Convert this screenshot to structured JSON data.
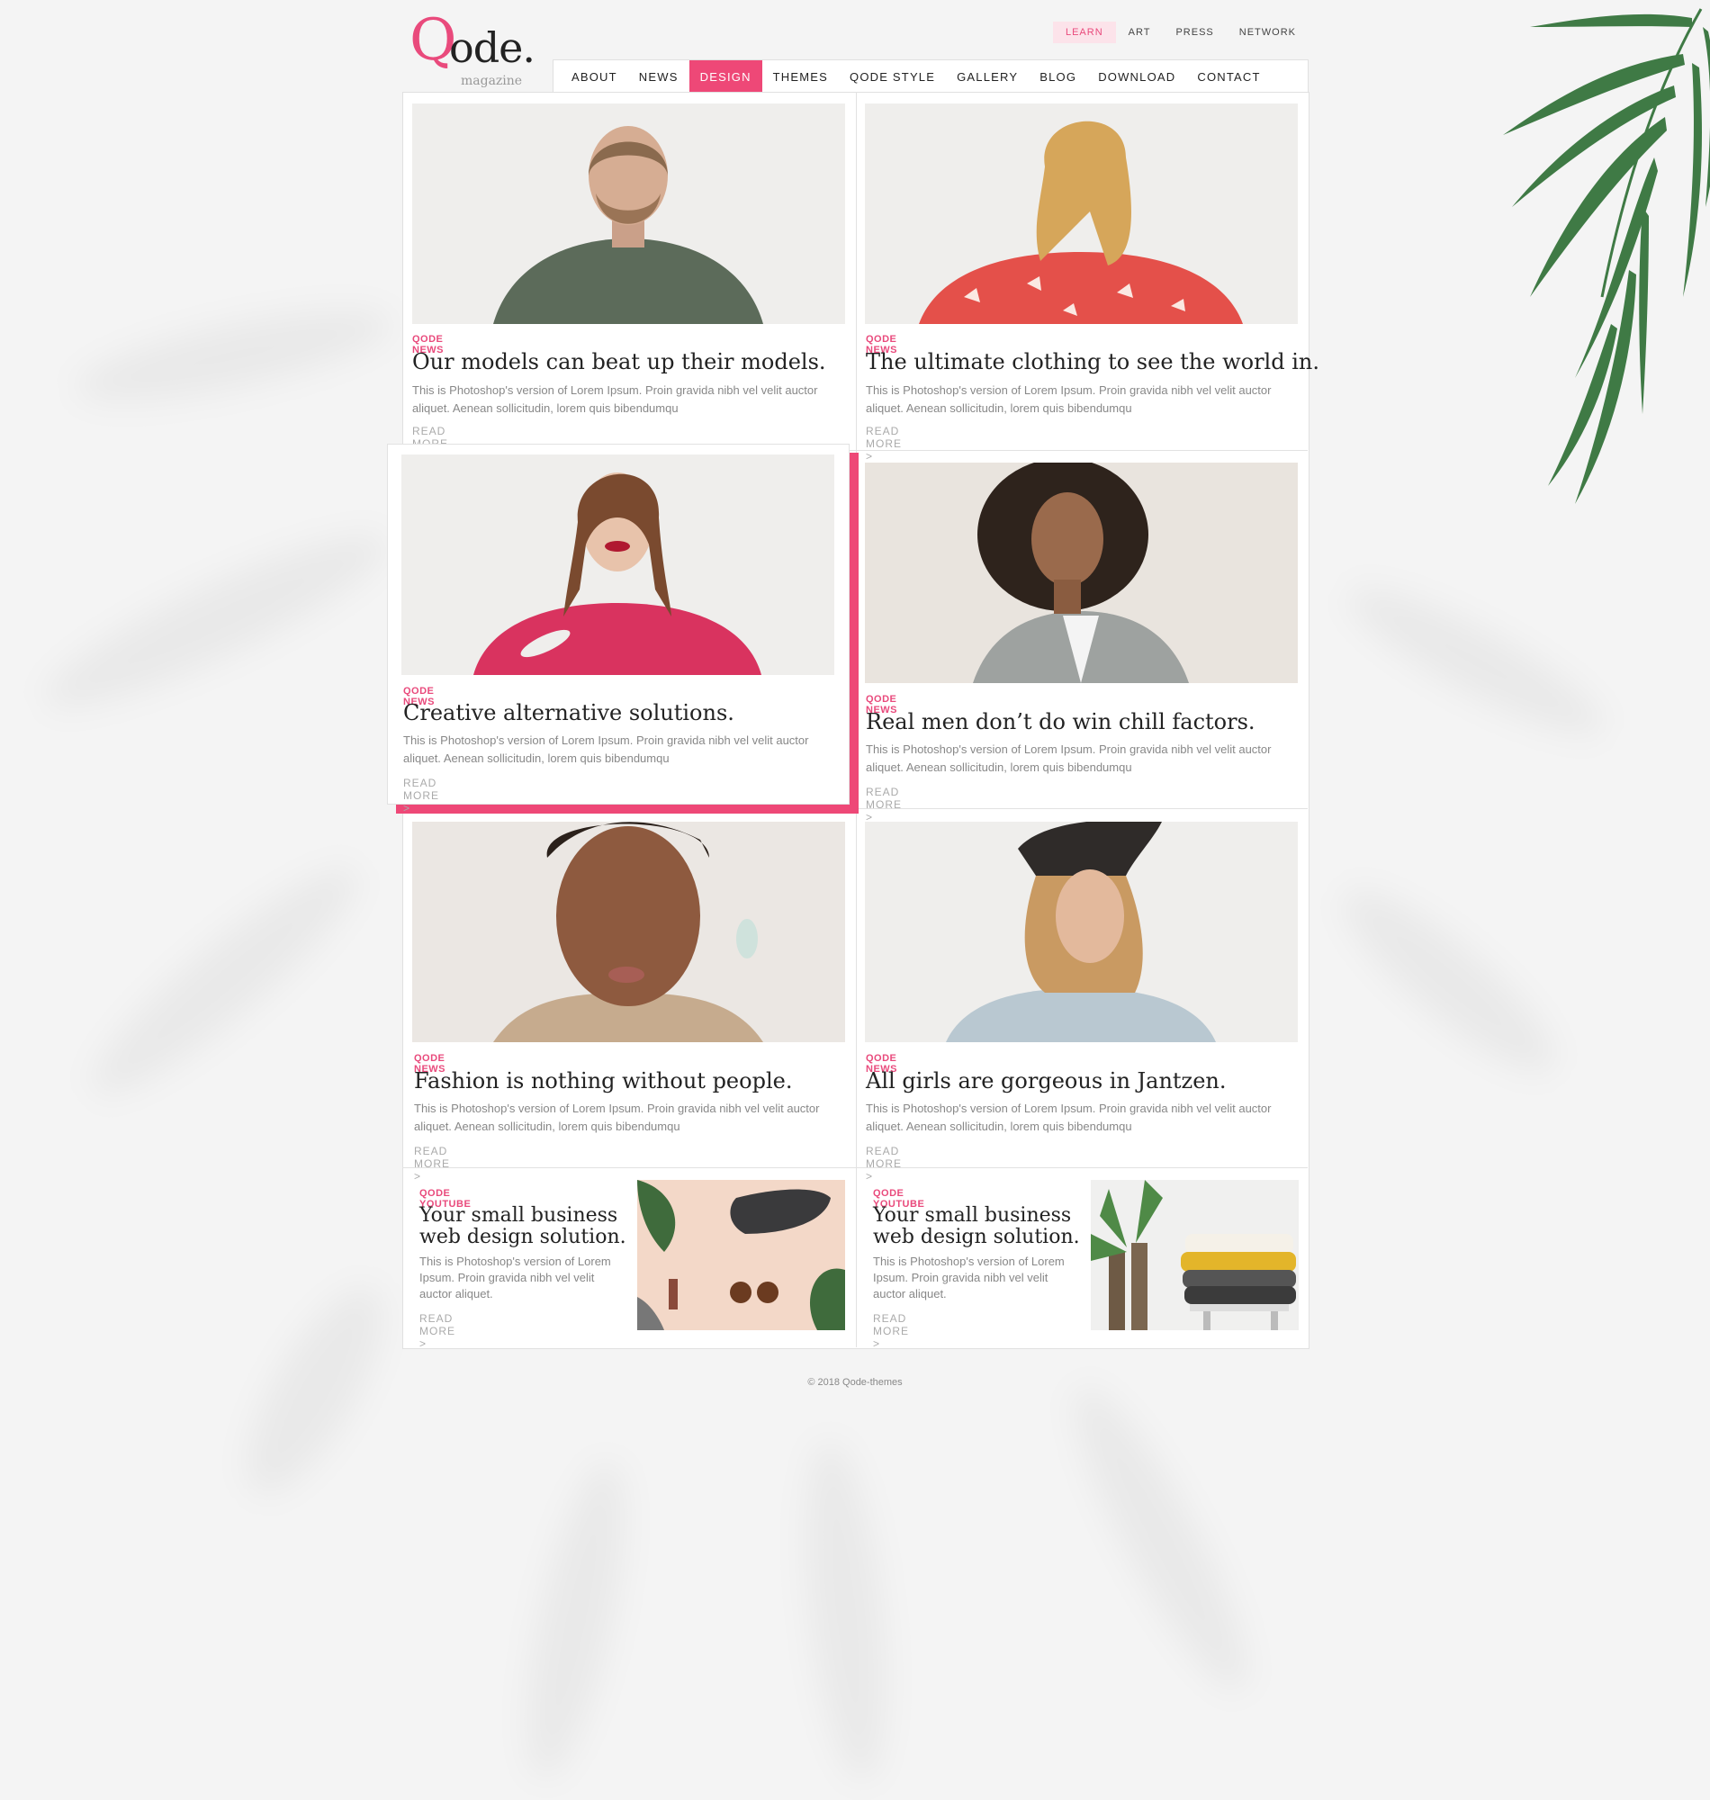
{
  "logo": {
    "q": "Q",
    "ode": "ode.",
    "sub": "magazine"
  },
  "top_nav": [
    {
      "label": "LEARN",
      "active": true
    },
    {
      "label": "ART",
      "active": false
    },
    {
      "label": "PRESS",
      "active": false
    },
    {
      "label": "NETWORK",
      "active": false
    }
  ],
  "main_nav": [
    {
      "label": "ABOUT",
      "active": false
    },
    {
      "label": "NEWS",
      "active": false
    },
    {
      "label": "DESIGN",
      "active": true
    },
    {
      "label": "THEMES",
      "active": false
    },
    {
      "label": "QODE STYLE",
      "active": false
    },
    {
      "label": "GALLERY",
      "active": false
    },
    {
      "label": "BLOG",
      "active": false
    },
    {
      "label": "DOWNLOAD",
      "active": false
    },
    {
      "label": "CONTACT",
      "active": false
    }
  ],
  "posts": [
    {
      "category": "QODE NEWS",
      "title": "Our models can beat up their models.",
      "excerpt": "This is Photoshop's version  of Lorem Ipsum. Proin gravida nibh vel velit auctor aliquet. Aenean sollicitudin, lorem quis bibendumqu",
      "more": "READ MORE >"
    },
    {
      "category": "QODE NEWS",
      "title": "The ultimate clothing to see the world in.",
      "excerpt": "This is Photoshop's version  of Lorem Ipsum. Proin gravida nibh vel velit auctor aliquet. Aenean sollicitudin, lorem quis bibendumqu",
      "more": "READ MORE >"
    },
    {
      "category": "QODE NEWS",
      "title": "Creative alternative solutions.",
      "excerpt": "This is Photoshop's version  of Lorem Ipsum. Proin gravida nibh vel velit auctor aliquet. Aenean sollicitudin, lorem quis bibendumqu",
      "more": "READ MORE >"
    },
    {
      "category": "QODE NEWS",
      "title": "Real men don’t do win chill factors.",
      "excerpt": "This is Photoshop's version  of Lorem Ipsum. Proin gravida nibh vel velit auctor aliquet. Aenean sollicitudin, lorem quis bibendumqu",
      "more": "READ MORE >"
    },
    {
      "category": "QODE NEWS",
      "title": "Fashion is nothing without people.",
      "excerpt": "This is Photoshop's version  of Lorem Ipsum. Proin gravida nibh vel velit auctor aliquet. Aenean sollicitudin, lorem quis bibendumqu",
      "more": "READ MORE >"
    },
    {
      "category": "QODE NEWS",
      "title": "All girls are gorgeous in Jantzen.",
      "excerpt": "This is Photoshop's version  of Lorem Ipsum. Proin gravida nibh vel velit auctor aliquet. Aenean sollicitudin, lorem quis bibendumqu",
      "more": "READ MORE >"
    }
  ],
  "small_posts": [
    {
      "category": "QODE YOUTUBE",
      "title1": "Your small business",
      "title2": "web design solution.",
      "excerpt": "This is Photoshop's version  of Lorem Ipsum. Proin gravida nibh vel velit auctor aliquet.",
      "more": "READ MORE >"
    },
    {
      "category": "QODE YOUTUBE",
      "title1": "Your small business",
      "title2": "web design solution.",
      "excerpt": "This is Photoshop's version  of Lorem Ipsum. Proin gravida nibh vel velit auctor aliquet.",
      "more": "READ MORE >"
    }
  ],
  "footer": {
    "copyright": "© 2018 Qode-themes"
  },
  "colors": {
    "accent": "#ee4877",
    "accent_text": "#e94a7c",
    "leaf": "#3f7a45"
  }
}
